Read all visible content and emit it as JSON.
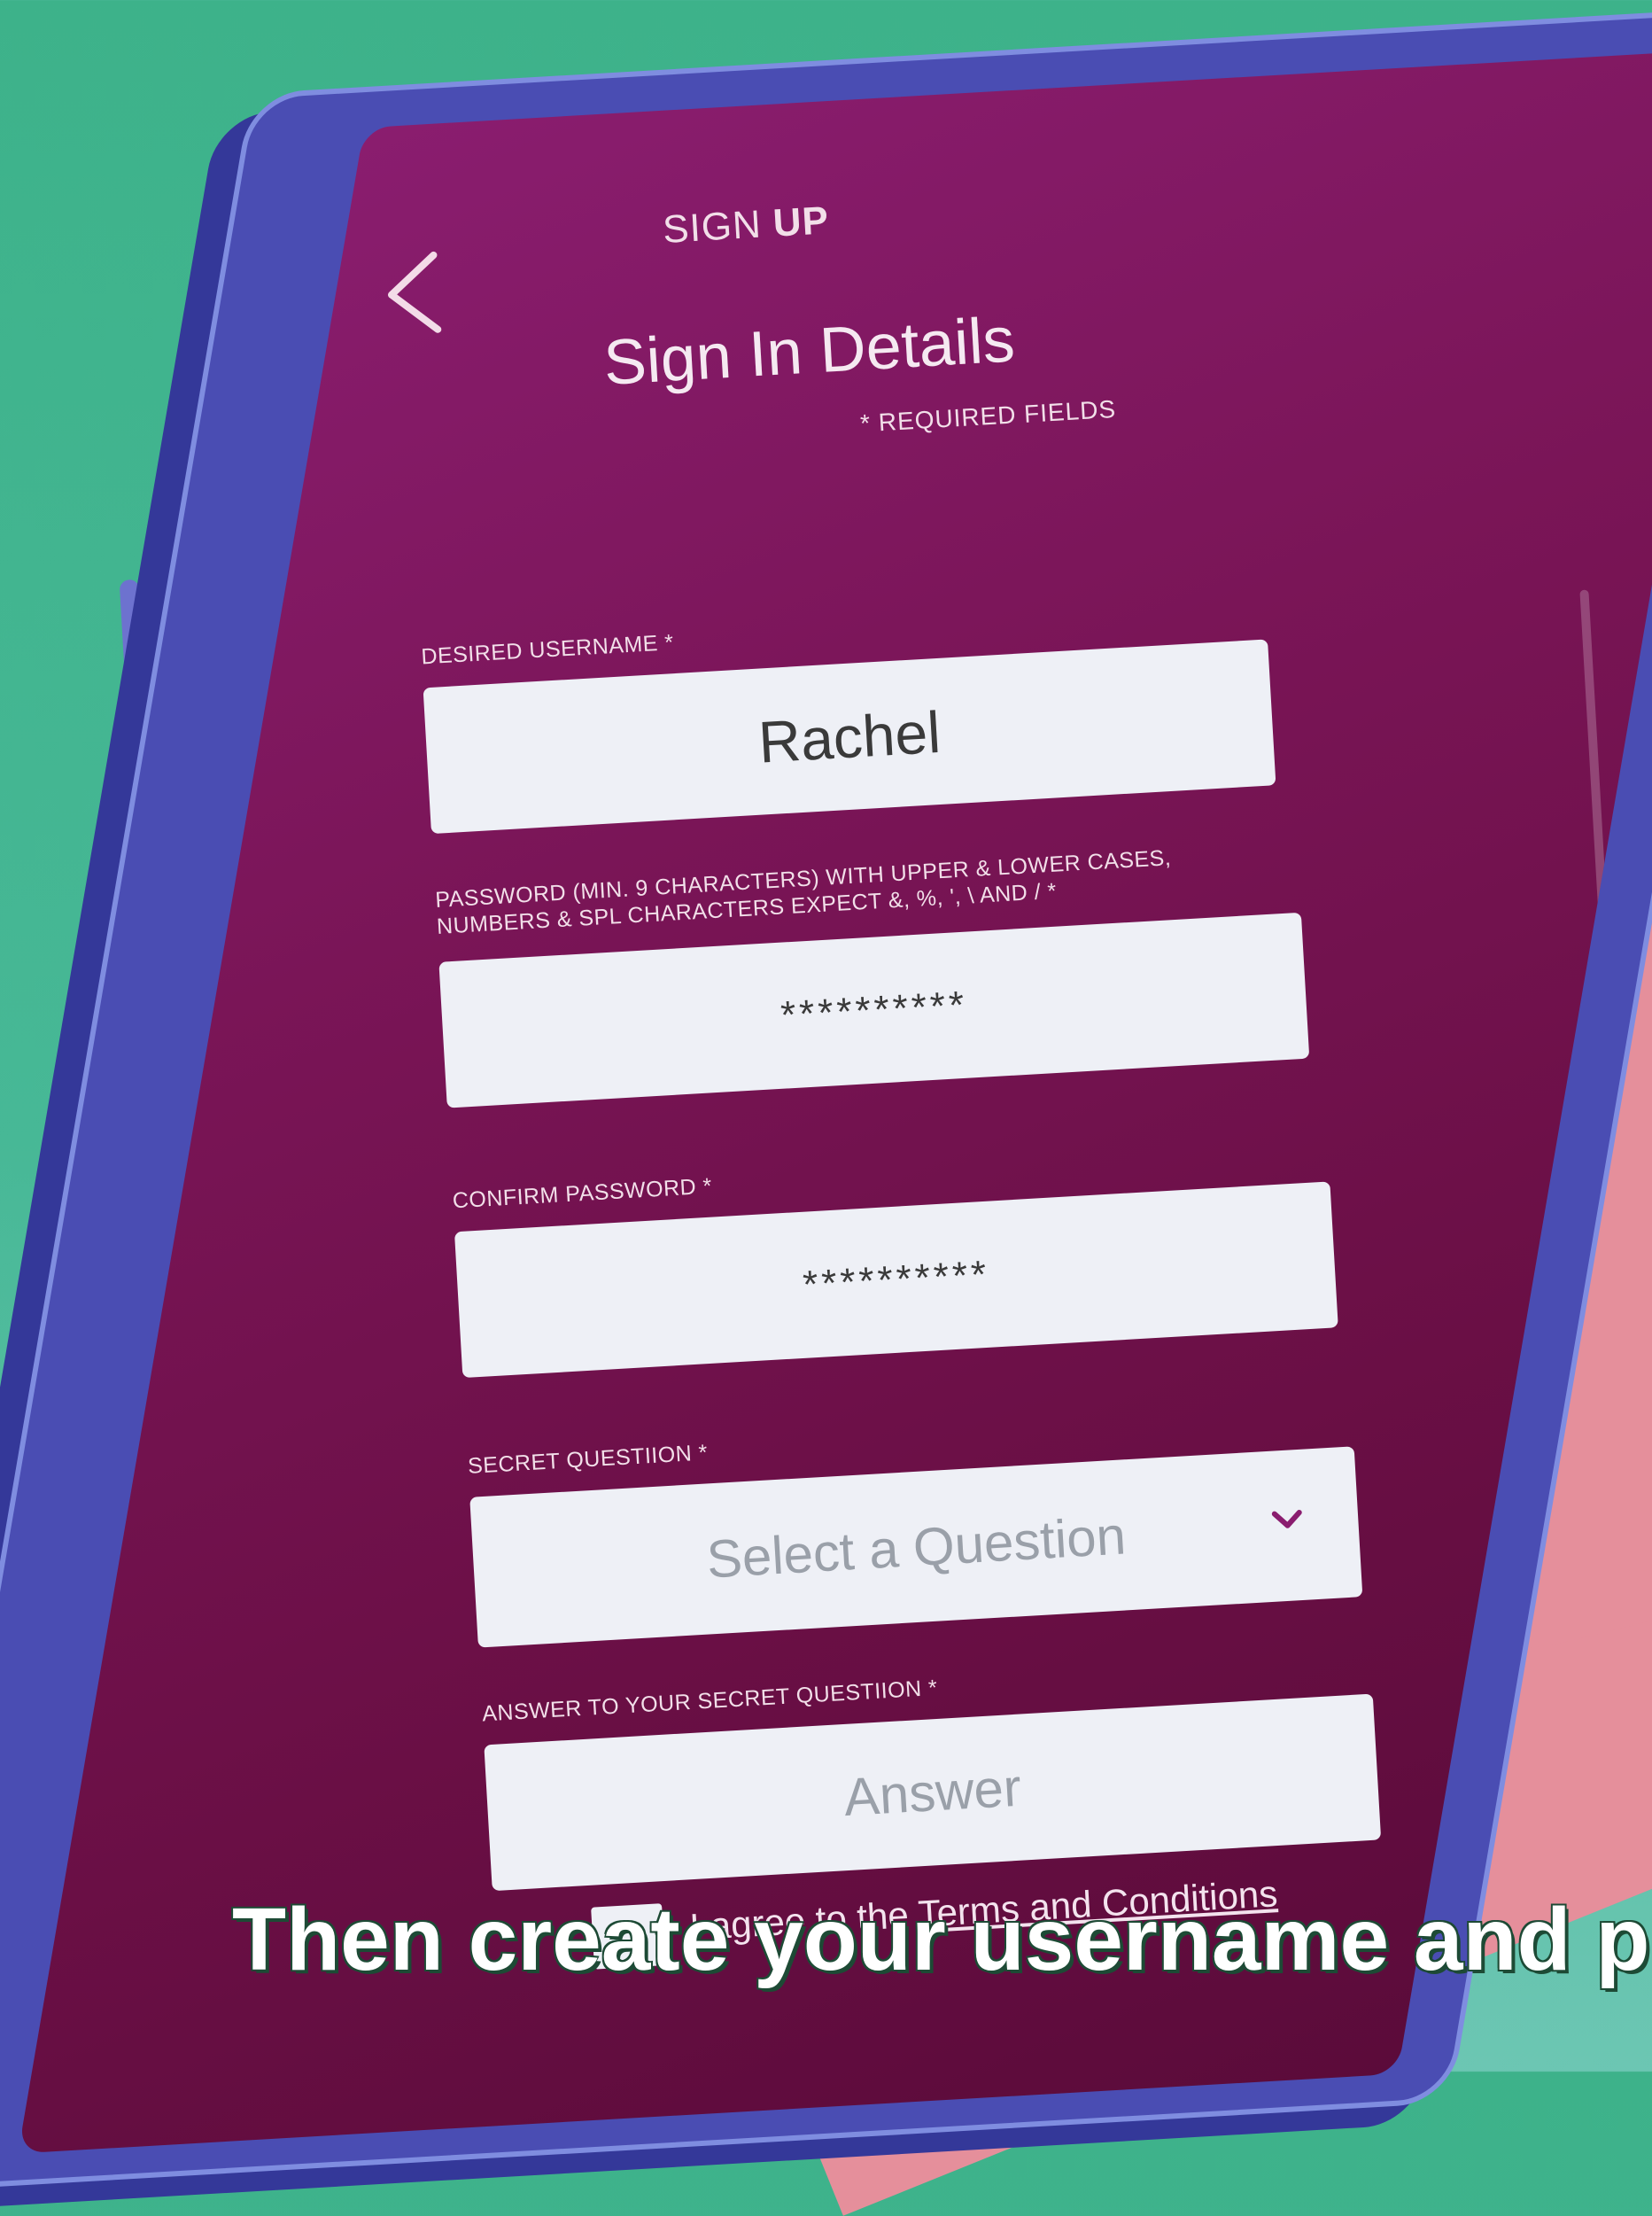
{
  "header": {
    "title_prefix": "SIGN",
    "title_bold": "UP",
    "heading": "Sign In Details",
    "required_note": "* REQUIRED FIELDS"
  },
  "form": {
    "username": {
      "label": "DESIRED USERNAME *",
      "value": "Rachel"
    },
    "password": {
      "label_line1": "PASSWORD (MIN. 9 CHARACTERS) WITH UPPER & LOWER CASES,",
      "label_line2": "NUMBERS & SPL CHARACTERS EXPECT &, %, ', \\ AND / *",
      "value": "**********"
    },
    "confirm_password": {
      "label": "CONFIRM PASSWORD *",
      "value": "**********"
    },
    "secret_question": {
      "label": "SECRET QUESTIION *",
      "placeholder": "Select a Question"
    },
    "secret_answer": {
      "label": "ANSWER TO YOUR SECRET QUESTIION *",
      "placeholder": "Answer"
    },
    "terms": {
      "text": "I agree to the",
      "link": "Terms and Conditions"
    }
  },
  "caption": {
    "text": "Then create your username and p"
  },
  "colors": {
    "background": "#3db28a",
    "screen": "#7a1557",
    "phone_body": "#4a4db3",
    "hand": "#e58f9b",
    "input": "#eef0f6",
    "chevron": "#8a1d6f"
  },
  "icons": {
    "back": "chevron-left-icon",
    "dropdown": "chevron-down-icon"
  }
}
